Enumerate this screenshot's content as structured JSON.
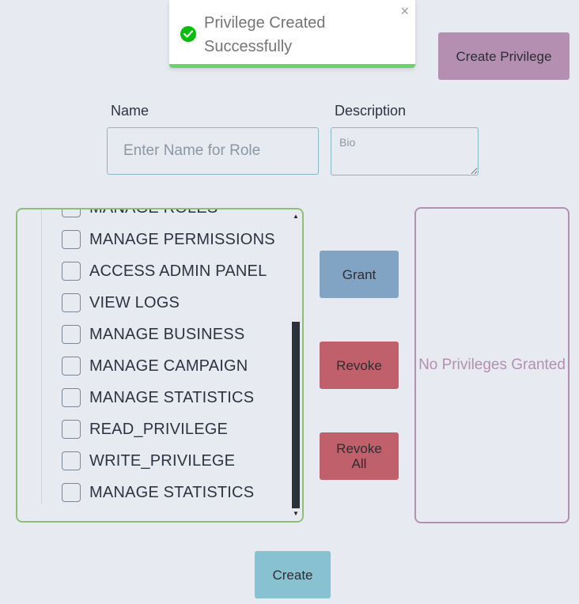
{
  "toast": {
    "line1": "Privilege Created",
    "line2": "Successfully",
    "close_glyph": "×",
    "icon": "check-circle-icon",
    "accent_color": "#07bc0c",
    "progress": 1.0
  },
  "header": {
    "create_privilege_label": "Create Privilege"
  },
  "form": {
    "name_label": "Name",
    "name_placeholder": "Enter Name for Role",
    "description_label": "Description",
    "description_placeholder": "Bio"
  },
  "privileges": {
    "items": [
      "MANAGE ROLES",
      "MANAGE PERMISSIONS",
      "ACCESS ADMIN PANEL",
      "VIEW LOGS",
      "MANAGE BUSINESS",
      "MANAGE CAMPAIGN",
      "MANAGE STATISTICS",
      "READ_PRIVILEGE",
      "WRITE_PRIVILEGE",
      "MANAGE STATISTICS"
    ]
  },
  "actions": {
    "grant_label": "Grant",
    "revoke_label": "Revoke",
    "revoke_all_line1": "Revoke",
    "revoke_all_line2": "All"
  },
  "granted": {
    "empty_text": "No Privileges Granted"
  },
  "footer": {
    "create_label": "Create"
  },
  "colors": {
    "background": "#e7eaf1",
    "create_privilege": "#b48fb1",
    "grant": "#81a3c4",
    "revoke": "#c0606a",
    "create": "#88c1cf",
    "list_border": "#8fbf76"
  }
}
